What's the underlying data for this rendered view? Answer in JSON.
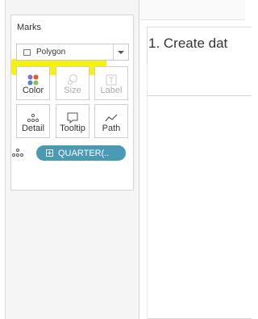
{
  "marks": {
    "title": "Marks",
    "mark_type": "Polygon",
    "tiles": [
      {
        "label": "Color",
        "icon": "color-icon",
        "enabled": true
      },
      {
        "label": "Size",
        "icon": "size-icon",
        "enabled": false
      },
      {
        "label": "Label",
        "icon": "label-icon",
        "enabled": false
      },
      {
        "label": "Detail",
        "icon": "detail-icon",
        "enabled": true
      },
      {
        "label": "Tooltip",
        "icon": "tooltip-icon",
        "enabled": true
      },
      {
        "label": "Path",
        "icon": "path-icon",
        "enabled": true
      }
    ],
    "pill": {
      "label": "QUARTER(..",
      "icon": "detail-dots-icon",
      "color": "#4a9ab5"
    }
  },
  "sheet": {
    "title": "1. Create dat"
  },
  "colors": {
    "highlight": "#f4f200",
    "pill": "#4a9ab5"
  }
}
